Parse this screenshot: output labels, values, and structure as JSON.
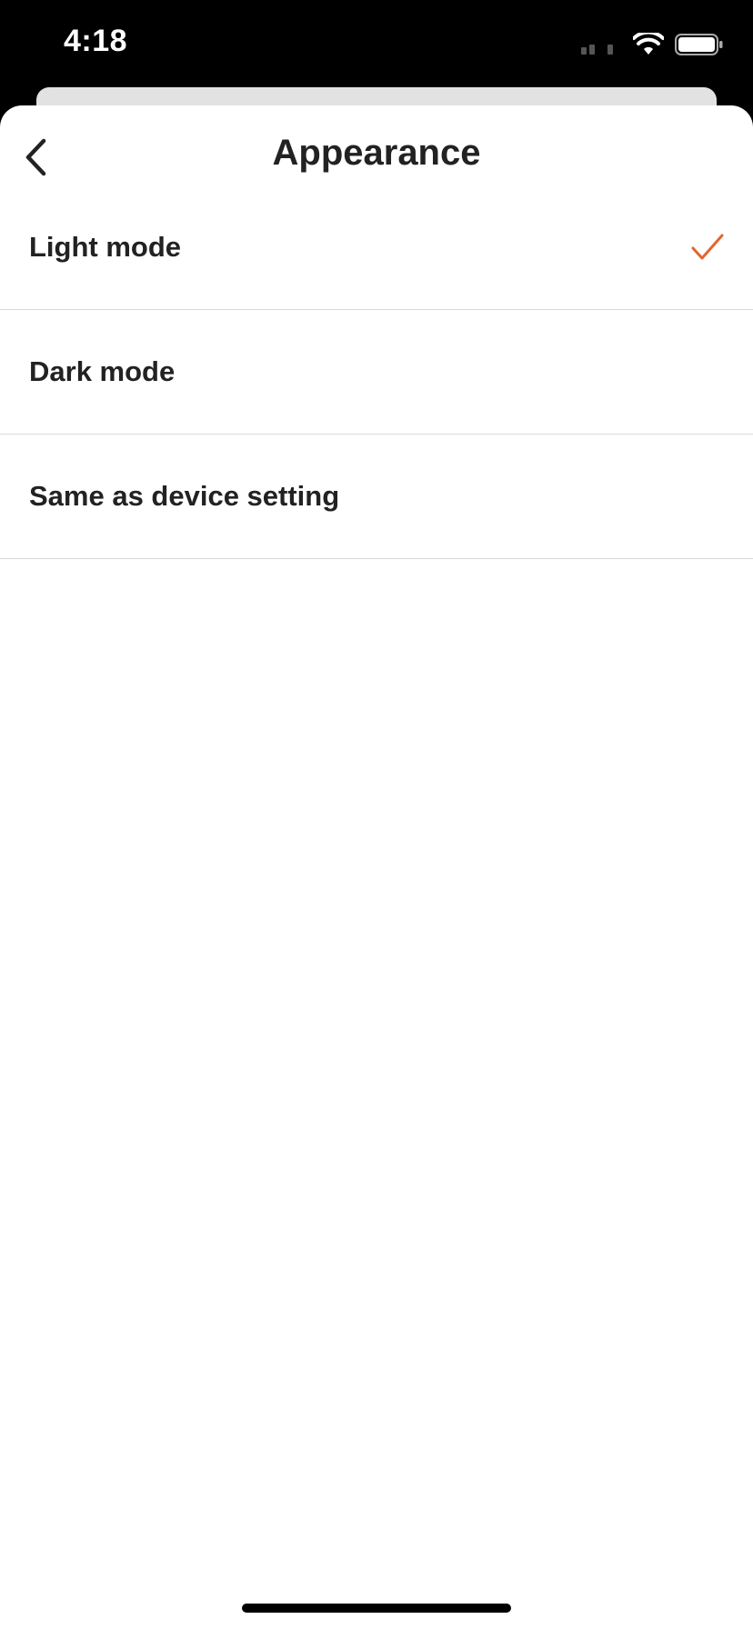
{
  "status_bar": {
    "time": "4:18"
  },
  "nav": {
    "title": "Appearance",
    "back_icon": "chevron-left-icon"
  },
  "options": [
    {
      "label": "Light mode",
      "selected": true
    },
    {
      "label": "Dark mode",
      "selected": false
    },
    {
      "label": "Same as device setting",
      "selected": false
    }
  ],
  "colors": {
    "accent": "#E5642F",
    "text": "#222222",
    "divider": "#D9D9D9"
  }
}
